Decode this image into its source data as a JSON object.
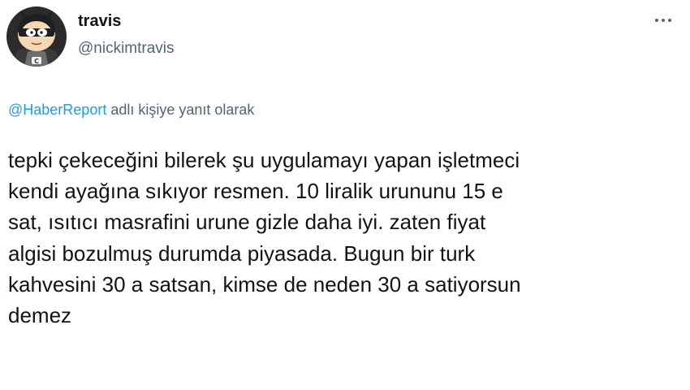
{
  "author": {
    "display_name": "travis",
    "handle": "@nickimtravis",
    "avatar_icon": "south-park-cartoon-avatar"
  },
  "menu_icon": "more-options-icon",
  "reply_context": {
    "mention": "@HaberReport",
    "suffix": " adlı kişiye yanıt olarak"
  },
  "tweet": {
    "text": "tepki çekeceğini bilerek şu uygulamayı yapan işletmeci\nkendi ayağına sıkıyor resmen. 10 liralik urununu 15 e\nsat, ısıtıcı masrafini urune gizle daha iyi. zaten fiyat\nalgisi bozulmuş durumda piyasada. Bugun bir turk\nkahvesini 30 a satsan, kimse de neden 30 a satiyorsun\ndemez"
  },
  "colors": {
    "link": "#1d9bf0",
    "secondary_text": "#536471",
    "primary_text": "#0f1419"
  }
}
